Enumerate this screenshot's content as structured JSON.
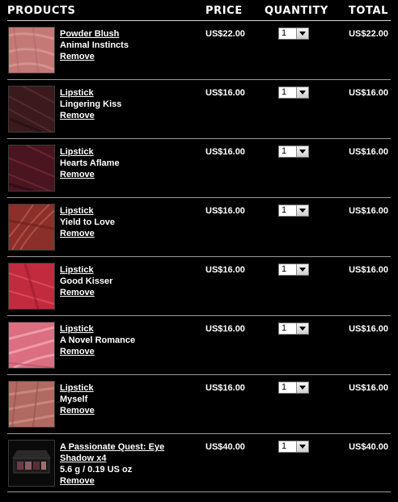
{
  "header": {
    "products": "PRODUCTS",
    "price": "PRICE",
    "quantity": "QUANTITY",
    "total": "TOTAL"
  },
  "remove_label": "Remove",
  "items": [
    {
      "name": "Powder Blush",
      "shade": "Animal Instincts",
      "size": "",
      "price": "US$22.00",
      "quantity": "1",
      "total": "US$22.00",
      "swatch": "#c9837f"
    },
    {
      "name": "Lipstick",
      "shade": "Lingering Kiss",
      "size": "",
      "price": "US$16.00",
      "quantity": "1",
      "total": "US$16.00",
      "swatch": "#3b1a1e"
    },
    {
      "name": "Lipstick",
      "shade": "Hearts Aflame",
      "size": "",
      "price": "US$16.00",
      "quantity": "1",
      "total": "US$16.00",
      "swatch": "#4a1420"
    },
    {
      "name": "Lipstick",
      "shade": "Yield to Love",
      "size": "",
      "price": "US$16.00",
      "quantity": "1",
      "total": "US$16.00",
      "swatch": "#8a2f2a"
    },
    {
      "name": "Lipstick",
      "shade": "Good Kisser",
      "size": "",
      "price": "US$16.00",
      "quantity": "1",
      "total": "US$16.00",
      "swatch": "#c22a3e"
    },
    {
      "name": "Lipstick",
      "shade": "A Novel Romance",
      "size": "",
      "price": "US$16.00",
      "quantity": "1",
      "total": "US$16.00",
      "swatch": "#db6e80"
    },
    {
      "name": "Lipstick",
      "shade": "Myself",
      "size": "",
      "price": "US$16.00",
      "quantity": "1",
      "total": "US$16.00",
      "swatch": "#b06a62"
    },
    {
      "name": "A Passionate Quest: Eye Shadow x4",
      "shade": "",
      "size": "5.6 g / 0.19 US oz",
      "price": "US$40.00",
      "quantity": "1",
      "total": "US$40.00",
      "swatch": "#1a1a1a"
    }
  ]
}
